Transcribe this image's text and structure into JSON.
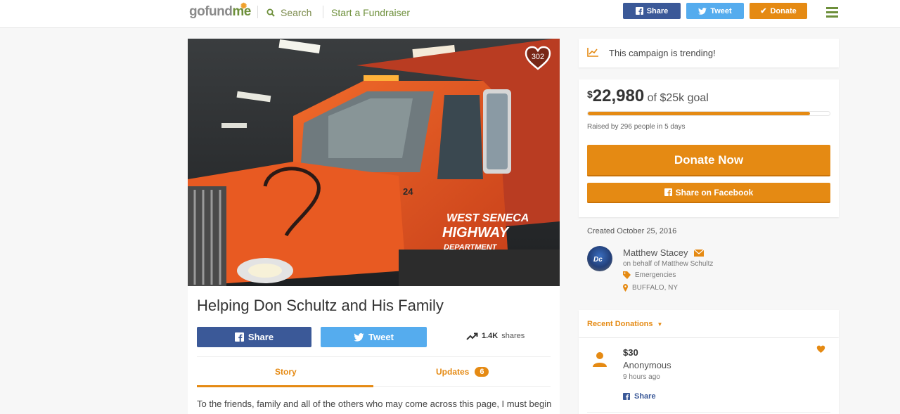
{
  "header": {
    "logo": {
      "part1": "gofund",
      "part2": "me"
    },
    "search_label": "Search",
    "start_label": "Start a Fundraiser",
    "share_label": "Share",
    "tweet_label": "Tweet",
    "donate_label": "Donate"
  },
  "campaign": {
    "heart_count": "302",
    "title": "Helping Don Schultz and His Family",
    "share_label": "Share",
    "tweet_label": "Tweet",
    "shares_count": "1.4K",
    "shares_word": "shares",
    "tabs": {
      "story": "Story",
      "updates": "Updates",
      "updates_count": "6"
    },
    "story_text": "To the friends, family and all of the others who may come across this page, I must begin"
  },
  "sidebar": {
    "trending": "This campaign is trending!",
    "currency": "$",
    "amount": "22,980",
    "goal": "of $25k goal",
    "progress": 0.92,
    "raised_by": "Raised by 296 people in 5 days",
    "donate_now": "Donate Now",
    "share_fb": "Share on Facebook",
    "created": "Created October 25, 2016",
    "organizer": "Matthew Stacey",
    "behalf": "on behalf of Matthew Schultz",
    "category": "Emergencies",
    "location": "BUFFALO, NY",
    "recent_label": "Recent Donations",
    "donation": {
      "amount": "$30",
      "name": "Anonymous",
      "time": "9 hours ago",
      "share": "Share"
    }
  },
  "colors": {
    "accent": "#e58a13",
    "facebook": "#3b5998",
    "twitter": "#55acee",
    "brand_green": "#6d8f3a"
  }
}
